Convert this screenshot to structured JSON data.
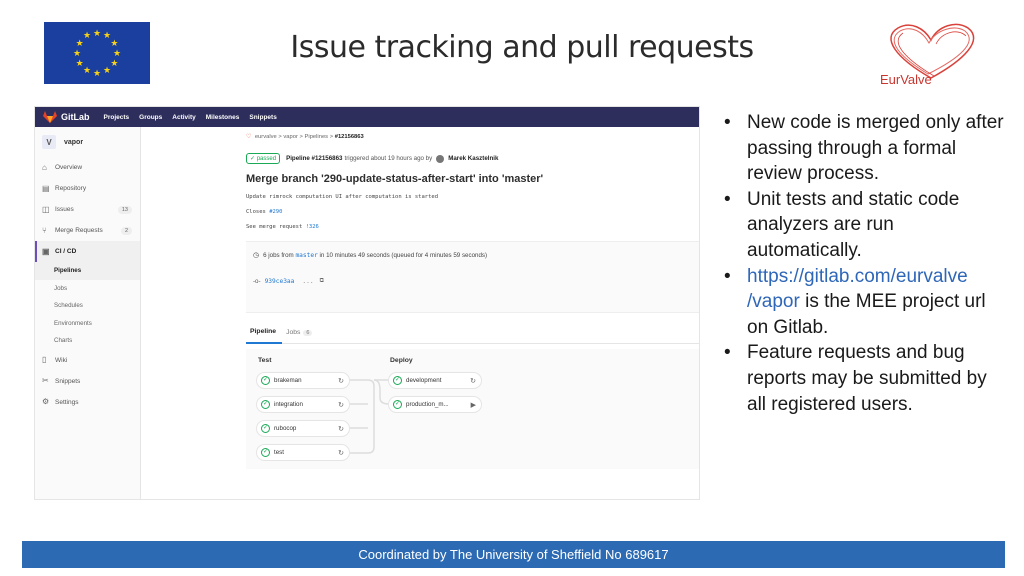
{
  "slide": {
    "title": "Issue tracking and pull requests",
    "logo_text": "EurValve",
    "footer": "Coordinated by The University of Sheffield No 689617"
  },
  "colors": {
    "footer_bg": "#2c6bb3",
    "eu_flag": "#1a3f9e",
    "gitlab_topbar": "#2e2e5c",
    "passed_green": "#1aaa55",
    "link_blue": "#1f78d1"
  },
  "gitlab": {
    "brand": "GitLab",
    "top_nav": [
      "Projects",
      "Groups",
      "Activity",
      "Milestones",
      "Snippets"
    ],
    "project": {
      "avatar": "V",
      "name": "vapor"
    },
    "sidebar": [
      {
        "label": "Overview",
        "icon": "home-icon"
      },
      {
        "label": "Repository",
        "icon": "doc-icon"
      },
      {
        "label": "Issues",
        "icon": "issues-icon",
        "count": "13"
      },
      {
        "label": "Merge Requests",
        "icon": "merge-icon",
        "count": "2"
      },
      {
        "label": "CI / CD",
        "icon": "rocket-icon"
      },
      {
        "label": "Wiki",
        "icon": "book-icon"
      },
      {
        "label": "Snippets",
        "icon": "scissors-icon"
      },
      {
        "label": "Settings",
        "icon": "gear-icon"
      }
    ],
    "cicd_sub": [
      "Pipelines",
      "Jobs",
      "Schedules",
      "Environments",
      "Charts"
    ],
    "breadcrumb": {
      "items": [
        "eurvalve",
        "vapor",
        "Pipelines"
      ],
      "current": "#12156863",
      "sep": ">"
    },
    "status": {
      "badge": "passed",
      "pipeline": "Pipeline #12156863",
      "triggered": "triggered about 19 hours ago by",
      "user": "Marek Kasztelnik"
    },
    "commit": {
      "title": "Merge branch '290-update-status-after-start' into 'master'",
      "line1": "Update rimrock computation UI after computation is started",
      "closes_label": "Closes",
      "closes_ref": "#290",
      "see_label": "See merge request",
      "see_ref": "!326"
    },
    "info": {
      "jobs_prefix": "6 jobs from",
      "branch": "master",
      "duration": "in 10 minutes 49 seconds (queued for 4 minutes 59 seconds)",
      "sha": "939ce3aa",
      "ellipsis": "..."
    },
    "tabs": [
      {
        "label": "Pipeline",
        "count": ""
      },
      {
        "label": "Jobs",
        "count": "6"
      }
    ],
    "stages": [
      {
        "title": "Test",
        "jobs": [
          "brakeman",
          "integration",
          "rubocop",
          "test"
        ]
      },
      {
        "title": "Deploy",
        "jobs": [
          "development",
          "production_m..."
        ]
      }
    ]
  },
  "bullets": [
    {
      "text": "New code is merged only after passing through a formal review process."
    },
    {
      "text": "Unit tests and static code analyzers are run automatically."
    },
    {
      "url": "https://gitlab.com/eurvalve/vapor",
      "url_line1": "https://gitlab.com/eurvalve",
      "url_line2": "/vapor",
      "text": " is the MEE project url on Gitlab."
    },
    {
      "text": "Feature requests and bug reports may be submitted by all registered users."
    }
  ]
}
